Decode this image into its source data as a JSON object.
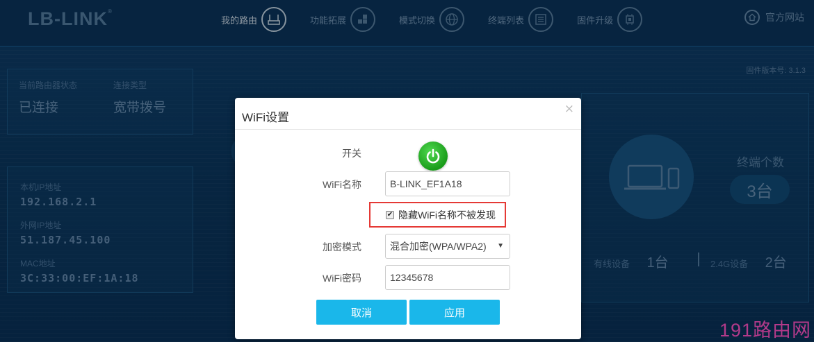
{
  "brand": {
    "logo": "LB-LINK",
    "logo_mark": "®"
  },
  "nav": {
    "items": [
      {
        "label": "我的路由",
        "icon": "router-icon",
        "active": true
      },
      {
        "label": "功能拓展",
        "icon": "blocks-icon",
        "active": false
      },
      {
        "label": "模式切换",
        "icon": "globe-icon",
        "active": false
      },
      {
        "label": "终端列表",
        "icon": "list-icon",
        "active": false
      },
      {
        "label": "固件升级",
        "icon": "chip-icon",
        "active": false
      }
    ],
    "site_link": "官方网站"
  },
  "firmware": {
    "label": "固件版本号: 3.1.3"
  },
  "status": {
    "router_state_label": "当前路由器状态",
    "router_state_value": "已连接",
    "conn_type_label": "连接类型",
    "conn_type_value": "宽带拨号"
  },
  "network": {
    "local_ip_label": "本机IP地址",
    "local_ip_value": "192.168.2.1",
    "wan_ip_label": "外网IP地址",
    "wan_ip_value": "51.187.45.100",
    "mac_label": "MAC地址",
    "mac_value": "3C:33:00:EF:1A:18"
  },
  "devices": {
    "count_title": "终端个数",
    "count_value": "3台",
    "wired_label": "有线设备",
    "wired_value": "1台",
    "g24_label": "2.4G设备",
    "g24_value": "2台"
  },
  "modal": {
    "title": "WiFi设置",
    "close": "×",
    "switch_label": "开关",
    "ssid_label": "WiFi名称",
    "ssid_value": "B-LINK_EF1A18",
    "hide_ssid_label": "隐藏WiFi名称不被发现",
    "hide_ssid_checked": true,
    "encryption_label": "加密模式",
    "encryption_value": "混合加密(WPA/WPA2)",
    "password_label": "WiFi密码",
    "password_value": "12345678",
    "cancel_label": "取消",
    "apply_label": "应用"
  },
  "watermark": "191路由网",
  "colors": {
    "accent": "#1ab7ea",
    "power_on": "#1fae1f",
    "highlight": "#e53935"
  }
}
